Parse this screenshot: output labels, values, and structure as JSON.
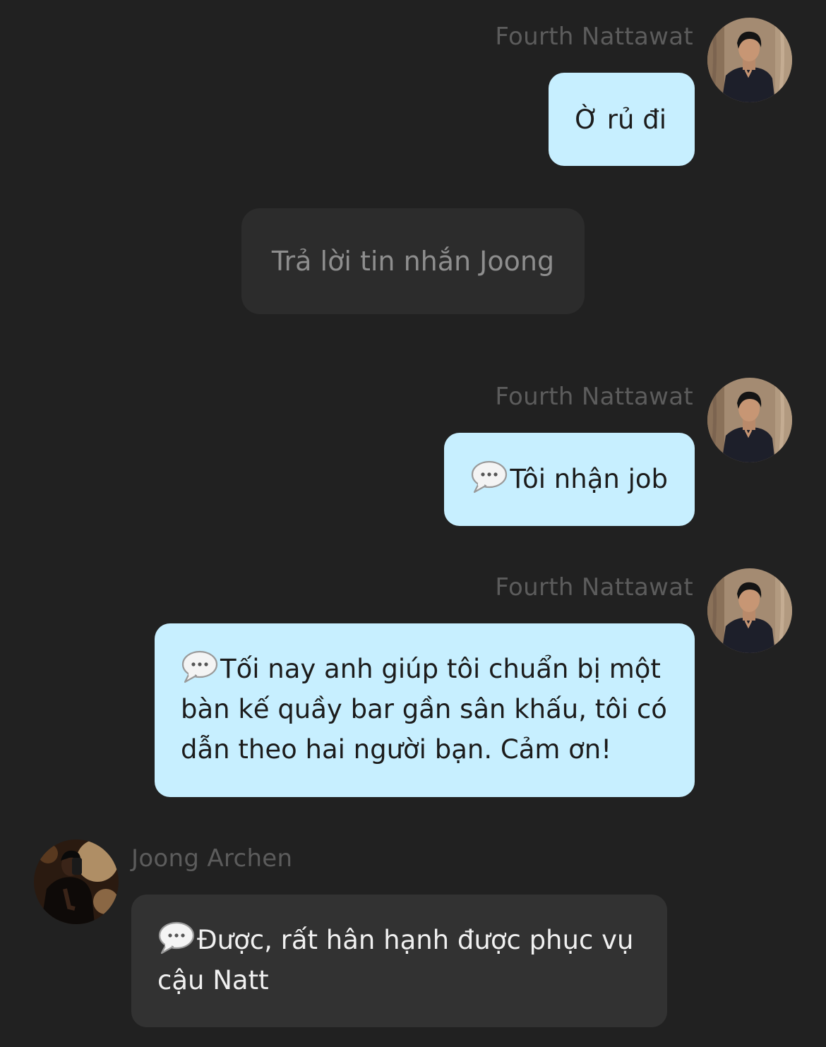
{
  "messages": [
    {
      "sender": "Fourth Nattawat",
      "text": "Ờ rủ đi"
    },
    {
      "sender": "Fourth Nattawat",
      "text": "Tôi nhận job"
    },
    {
      "sender": "Fourth Nattawat",
      "text": "Tối nay anh giúp tôi chuẩn bị một bàn kế quầy bar gần sân khấu, tôi có dẫn theo hai người bạn. Cảm ơn!"
    },
    {
      "sender": "Joong Archen",
      "text": "Được, rất hân hạnh được phục vụ cậu Natt"
    }
  ],
  "system_prompt": "Trả lời tin nhắn Joong",
  "icons": {
    "message_prefix": "speech-bubble-icon"
  },
  "colors": {
    "background": "#212121",
    "outgoing_bubble": "#c7efff",
    "incoming_bubble": "#323232",
    "sender_name": "#5c5c5c"
  }
}
